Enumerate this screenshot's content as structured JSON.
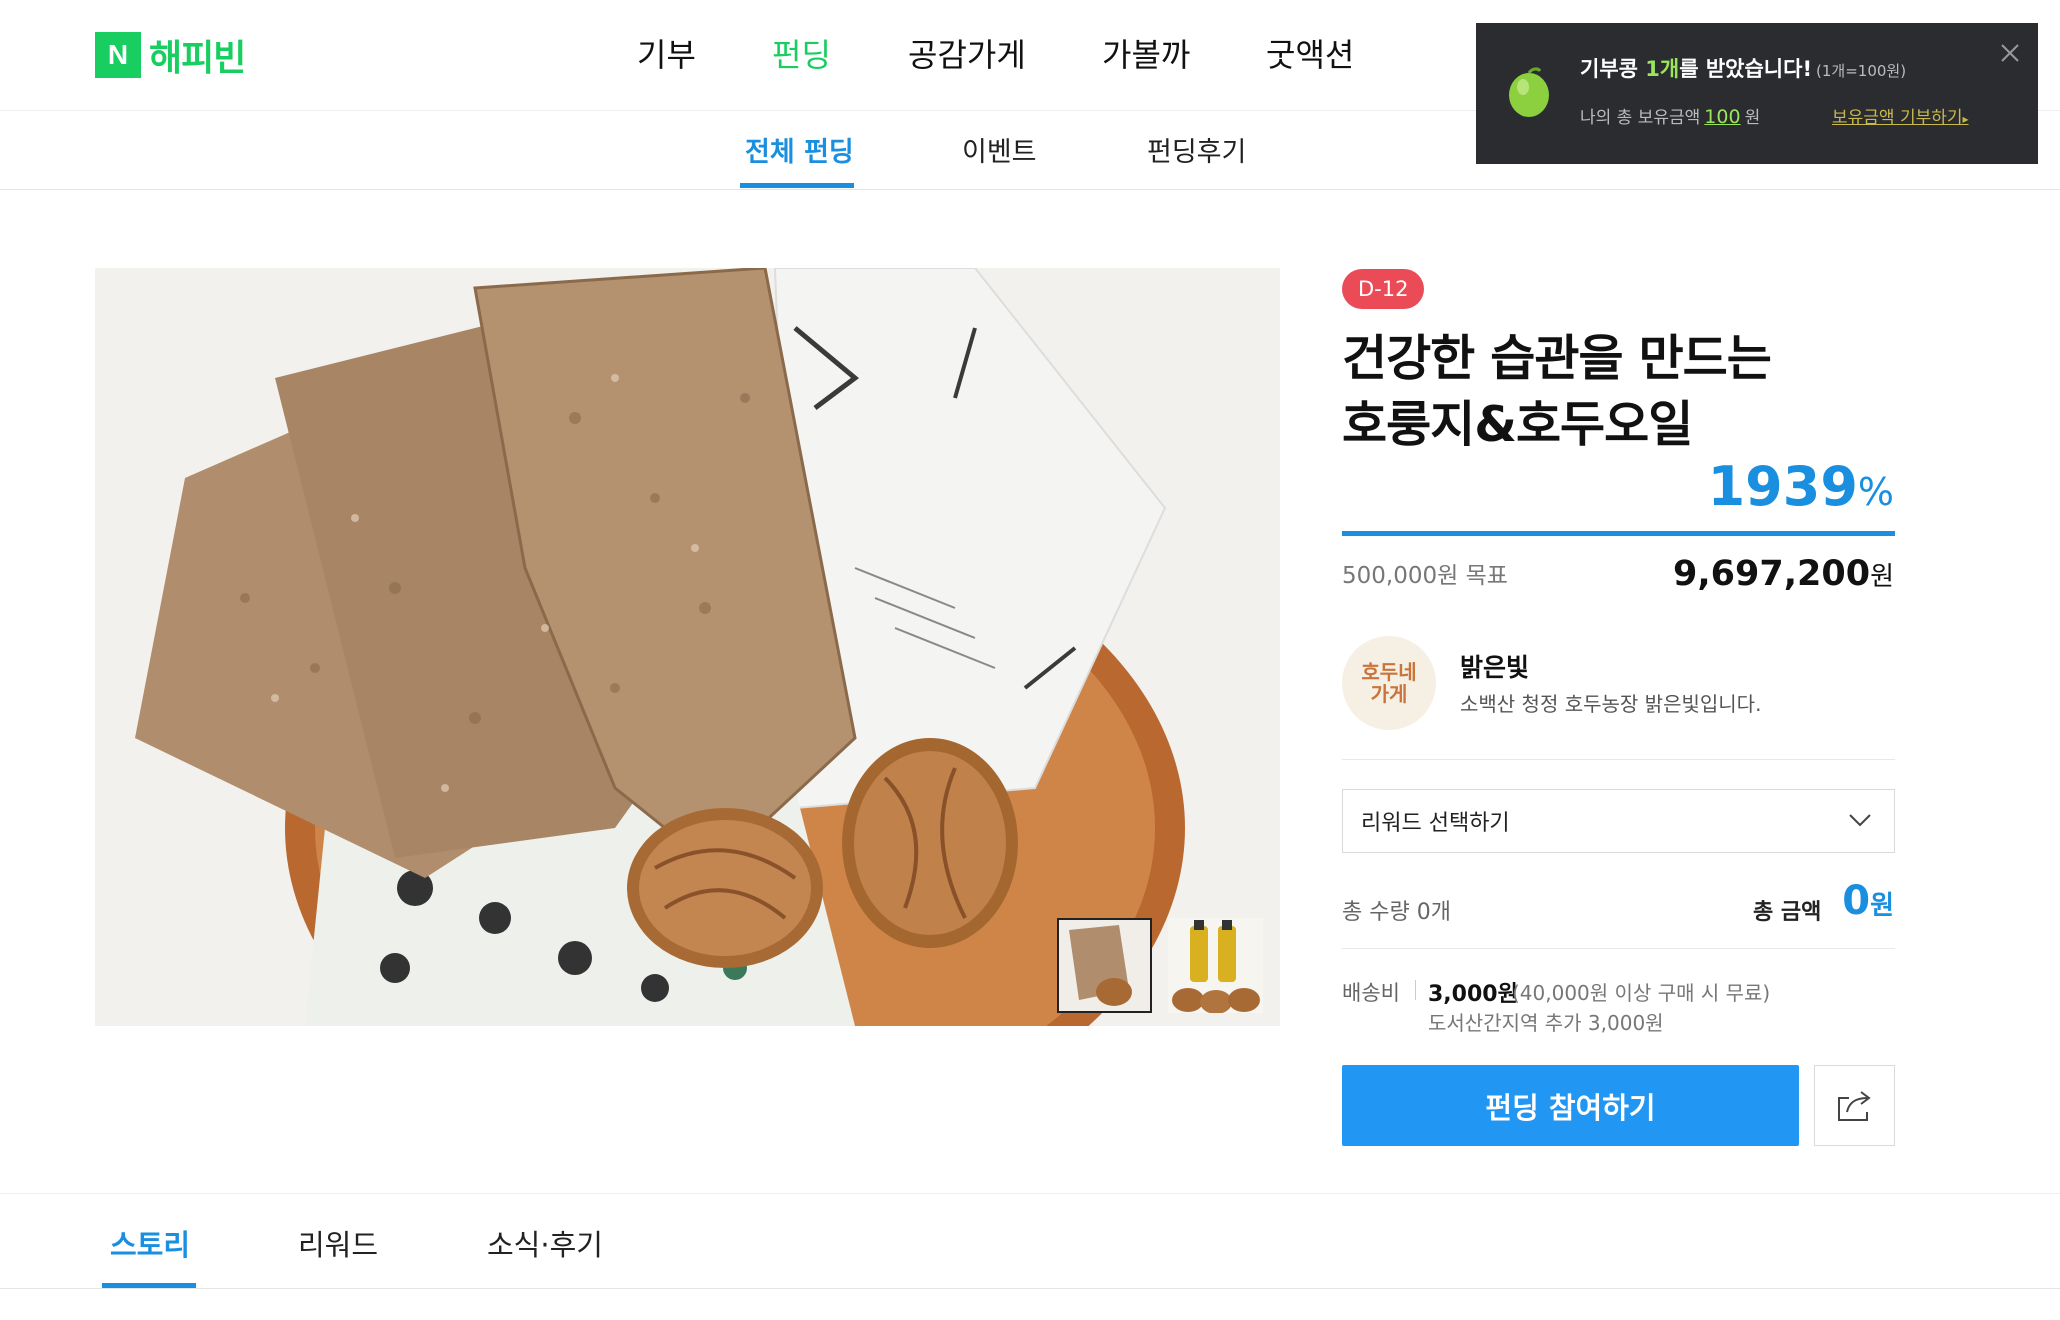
{
  "header": {
    "logo_mark": "N",
    "logo_text": "해피빈",
    "nav": [
      {
        "label": "기부"
      },
      {
        "label": "펀딩",
        "active": true
      },
      {
        "label": "공감가게"
      },
      {
        "label": "가볼까"
      },
      {
        "label": "굿액션"
      }
    ]
  },
  "subnav": {
    "items": [
      {
        "label": "전체 펀딩",
        "active": true
      },
      {
        "label": "이벤트"
      },
      {
        "label": "펀딩후기"
      }
    ]
  },
  "toast": {
    "prefix": "기부콩 ",
    "count": "1개",
    "suffix": "를 받았습니다!",
    "rate": "(1개=100원)",
    "balance_label": "나의 총 보유금액",
    "balance_amount": "100",
    "balance_unit": "원",
    "link_label": "보유금액 기부하기",
    "link_arrow": "▸"
  },
  "product": {
    "dday": "D-12",
    "title_line1": "건강한 습관을 만드는",
    "title_line2": "호룽지&호두오일",
    "percent": "1939",
    "percent_unit": "%",
    "progress_fraction": 1.0,
    "goal": "500,000원 목표",
    "raised": "9,697,200",
    "raised_unit": "원"
  },
  "shop": {
    "avatar_line1": "호두네",
    "avatar_line2": "가게",
    "name": "밝은빛",
    "desc": "소백산 청정 호두농장 밝은빛입니다."
  },
  "reward": {
    "placeholder": "리워드 선택하기"
  },
  "summary": {
    "qty_label": "총 수량",
    "qty_value": "0개",
    "total_label": "총 금액",
    "total_value": "0",
    "total_unit": "원"
  },
  "shipping": {
    "label": "배송비",
    "price": "3,000원",
    "note": "(40,000원 이상 구매 시 무료)",
    "extra": "도서산간지역 추가 3,000원"
  },
  "cta": {
    "label": "펀딩 참여하기"
  },
  "tabs": [
    {
      "label": "스토리",
      "active": true
    },
    {
      "label": "리워드"
    },
    {
      "label": "소식·후기"
    }
  ],
  "colors": {
    "brand_green": "#19ce60",
    "accent_blue": "#1a8fe0",
    "button_blue": "#2196f3",
    "dday_red": "#ea4b56",
    "toast_bg": "#2a2c30"
  },
  "icons": {
    "close": "close-icon",
    "chevron": "chevron-down-icon",
    "share": "share-icon",
    "bean": "bean-icon"
  }
}
